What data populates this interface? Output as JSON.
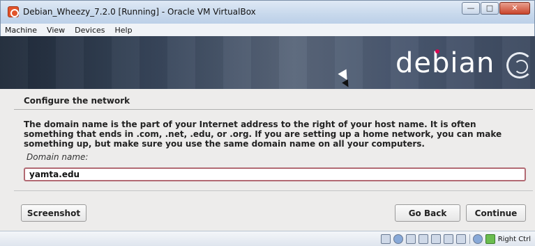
{
  "window": {
    "title": "Debian_Wheezy_7.2.0 [Running] - Oracle VM VirtualBox",
    "minimize_glyph": "—",
    "maximize_glyph": "□",
    "close_glyph": "✕"
  },
  "menu": {
    "items": [
      "Machine",
      "View",
      "Devices",
      "Help"
    ]
  },
  "banner": {
    "logo_text": "debian",
    "accent_color": "#d70751"
  },
  "installer": {
    "section_title": "Configure the network",
    "description": "The domain name is the part of your Internet address to the right of your host name.  It is often something that ends in .com, .net, .edu, or .org.  If you are setting up a home network, you can make something up, but make sure you use the same domain name on all your computers.",
    "field_label": "Domain name:",
    "field_value": "yamta.edu",
    "buttons": {
      "screenshot": "Screenshot",
      "go_back": "Go Back",
      "continue": "Continue"
    }
  },
  "statusbar": {
    "host_key": "Right Ctrl",
    "icons": [
      "hard-disk-icon",
      "optical-drive-icon",
      "usb-icon",
      "network-icon",
      "shared-folder-icon",
      "display-icon",
      "video-capture-icon",
      "mouse-integration-icon",
      "keyboard-capture-icon"
    ]
  }
}
